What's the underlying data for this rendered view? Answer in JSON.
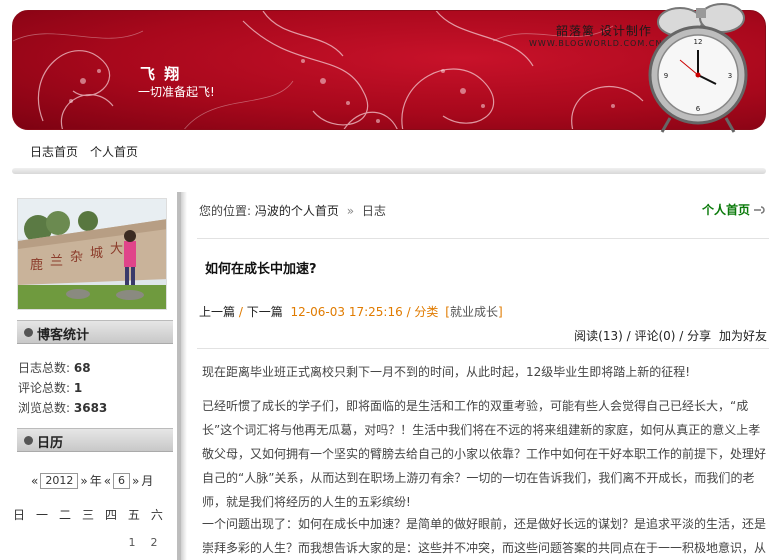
{
  "banner": {
    "site_title": "飞 翔",
    "site_subtitle": "一切准备起飞!",
    "credit_name": "韶落篱  设计制作",
    "credit_url": "WWW.BLOGWORLD.COM.CN"
  },
  "topnav": [
    "日志首页",
    "个人首页"
  ],
  "sidebar": {
    "stats_title": "博客统计",
    "stats": [
      {
        "label": "日志总数:",
        "value": "68"
      },
      {
        "label": "评论总数:",
        "value": "1"
      },
      {
        "label": "浏览总数:",
        "value": "3683"
      }
    ],
    "calendar_title": "日历",
    "calendar": {
      "year": "2012",
      "year_suffix": "年",
      "month": "6",
      "month_suffix": "月",
      "prev": "«",
      "next": "»",
      "weekdays": [
        "日",
        "一",
        "二",
        "三",
        "四",
        "五",
        "六"
      ],
      "first_row": [
        "",
        "",
        "",
        "",
        "",
        "1",
        "2"
      ]
    }
  },
  "breadcrumb": {
    "prefix": "您的位置:",
    "home": "冯波的个人首页",
    "sep": "»",
    "current": "日志"
  },
  "home_link": "个人首页",
  "post": {
    "title": "如何在成长中加速?",
    "prev": "上一篇",
    "next": "下一篇",
    "datetime": "12-06-03 17:25:16",
    "category_label": "分类",
    "category": "就业成长",
    "reads": "阅读(13)",
    "comments": "评论(0)",
    "share": "分享",
    "add_friend": "加为好友",
    "paragraphs": [
      "现在距离毕业班正式离校只剩下一月不到的时间，从此时起，12级毕业生即将踏上新的征程!",
      "已经听惯了成长的学子们，即将面临的是生活和工作的双重考验，可能有些人会觉得自己已经长大，“成长”这个词汇将与他再无瓜葛，对吗？！生活中我们将在不远的将来组建新的家庭，如何从真正的意义上孝敬父母，又如何拥有一个坚实的臂膀去给自己的小家以依靠？工作中如何在干好本职工作的前提下，处理好自己的“人脉”关系，从而达到在职场上游刃有余？一切的一切在告诉我们，我们离不开成长，而我们的老师，就是我们将经历的人生的五彩缤纷!",
      "一个问题出现了：如何在成长中加速？是简单的做好眼前，还是做好长远的谋划？是追求平淡的生活，还是崇拜多彩的人生？而我想告诉大家的是：这些并不冲突，而这些问题答案的共同点在于一一积极地意识，从"
    ]
  }
}
